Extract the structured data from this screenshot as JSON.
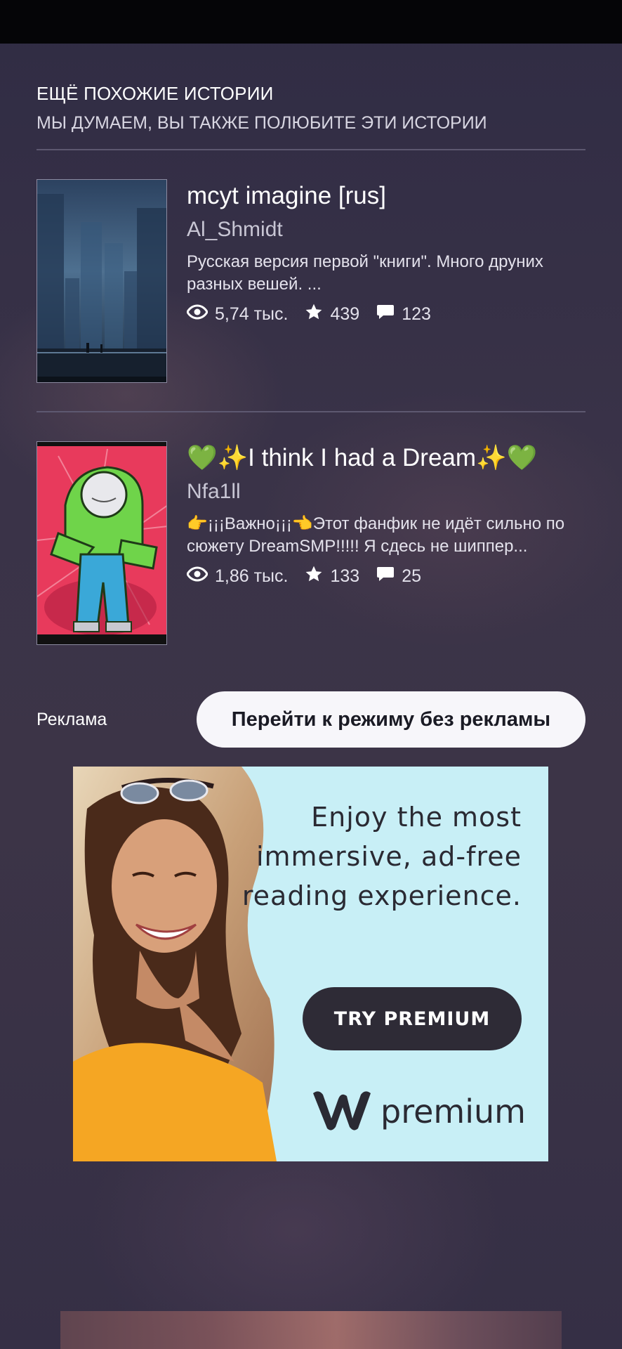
{
  "section": {
    "title": "ЕЩЁ ПОХОЖИЕ ИСТОРИИ",
    "subtitle": "МЫ ДУМАЕМ, ВЫ ТАКЖЕ ПОЛЮБИТЕ ЭТИ ИСТОРИИ"
  },
  "stories": [
    {
      "title": "mcyt imagine [rus]",
      "author": "Al_Shmidt",
      "description": "Русская версия первой \"книги\". Много друних разных вешей. ...",
      "reads": "5,74 тыс.",
      "votes": "439",
      "comments": "123"
    },
    {
      "title": "💚✨I think I had a Dream✨💚",
      "author": "Nfa1ll",
      "description": "👉¡¡¡Важно¡¡¡👈Этот фанфик не идёт сильно по сюжету DreamSMP!!!!! Я сдесь не шиппер...",
      "reads": "1,86 тыс.",
      "votes": "133",
      "comments": "25"
    }
  ],
  "ad": {
    "label": "Реклама",
    "adfree_button": "Перейти к режиму без рекламы",
    "headline": "Enjoy the most immersive, ad-free reading experience.",
    "cta": "TRY PREMIUM",
    "brand": "premium"
  },
  "icons": {
    "reads": "eye-icon",
    "votes": "star-icon",
    "comments": "comment-icon"
  },
  "colors": {
    "background": "#2e2a40",
    "ad_background": "#c8eff6",
    "cta_button": "#2e2b36"
  }
}
